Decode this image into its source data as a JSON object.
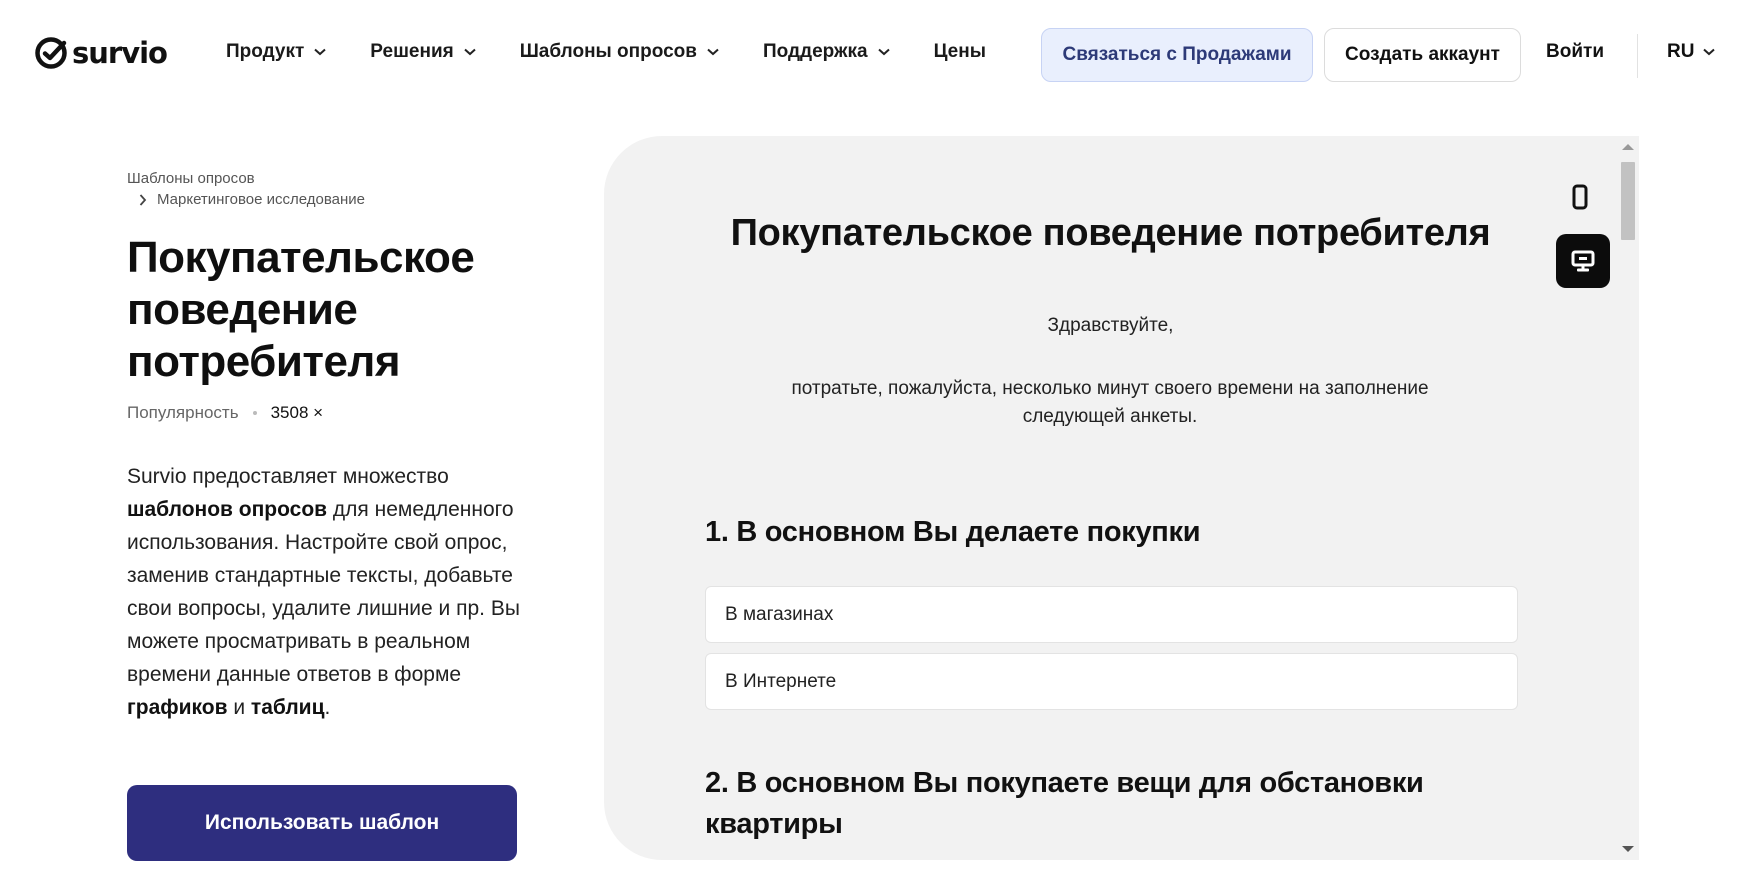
{
  "brand": {
    "name": "survio"
  },
  "nav": {
    "items": [
      {
        "label": "Продукт",
        "dropdown": true
      },
      {
        "label": "Решения",
        "dropdown": true
      },
      {
        "label": "Шаблоны опросов",
        "dropdown": true
      },
      {
        "label": "Поддержка",
        "dropdown": true
      },
      {
        "label": "Цены",
        "dropdown": false
      }
    ],
    "contact_sales": "Связаться с Продажами",
    "create_account": "Создать аккаунт",
    "login": "Войти",
    "language": "RU"
  },
  "breadcrumb": {
    "root": "Шаблоны опросов",
    "current": "Маркетинговое исследование"
  },
  "template": {
    "title": "Покупательское поведение потребителя",
    "popularity_label": "Популярность",
    "popularity_value": "3508 ×",
    "description": {
      "part1": "Survio предоставляет множество ",
      "bold1": "шаблонов опросов",
      "part2": " для немедленного использования. Настройте свой опрос, заменив стандартные тексты, добавьте свои вопросы, удалите лишние и пр. Вы можете просматривать в реальном времени данные ответов в форме ",
      "bold2": "графиков",
      "part3": " и ",
      "bold3": "таблиц",
      "part4": "."
    },
    "use_button": "Использовать шаблон"
  },
  "preview": {
    "title": "Покупательское поведение потребителя",
    "greeting": "Здравствуйте,",
    "intro": "потратьте, пожалуйста, несколько минут своего времени на заполнение следующей анкеты.",
    "questions": [
      {
        "title": "1. В основном Вы делаете покупки",
        "options": [
          "В магазинах",
          "В Интернете"
        ]
      },
      {
        "title": "2. В основном Вы покупаете вещи для обстановки квартиры"
      }
    ]
  },
  "colors": {
    "primary_button": "#2e2e7f",
    "sales_button_bg": "#e9effd",
    "sales_button_text": "#2d3a78",
    "preview_bg": "#f2f2f2"
  }
}
